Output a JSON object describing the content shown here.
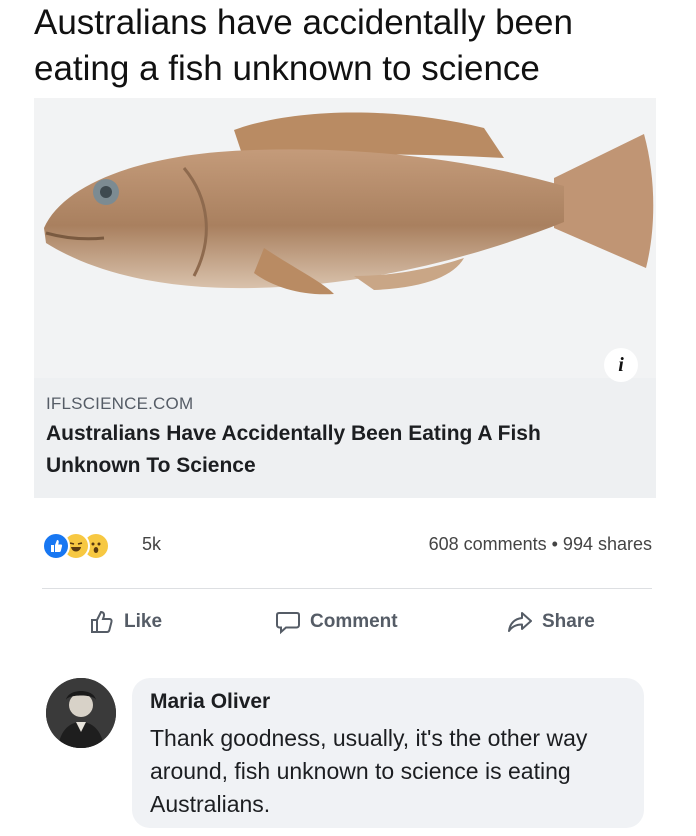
{
  "meme": {
    "title": "Australians have accidentally been eating a fish unknown to science"
  },
  "link_preview": {
    "image_subject": "fish",
    "info_icon": "i",
    "domain": "IFLSCIENCE.COM",
    "headline": "Australians Have Accidentally Been Eating A Fish Unknown To Science"
  },
  "reactions": {
    "icons": [
      "like-icon",
      "haha-icon",
      "wow-icon"
    ],
    "count": "5k",
    "comments_shares": "608 comments • 994 shares"
  },
  "actions": {
    "like": "Like",
    "comment": "Comment",
    "share": "Share"
  },
  "comment": {
    "author": "Maria Oliver",
    "text": "Thank goodness, usually, it's the other way around, fish unknown to science is eating Australians."
  },
  "colors": {
    "accent": "#1877f2",
    "text_primary": "#1c1e21",
    "text_secondary": "#555c66",
    "bubble": "#f0f2f5",
    "fish_body": "#b08968"
  }
}
